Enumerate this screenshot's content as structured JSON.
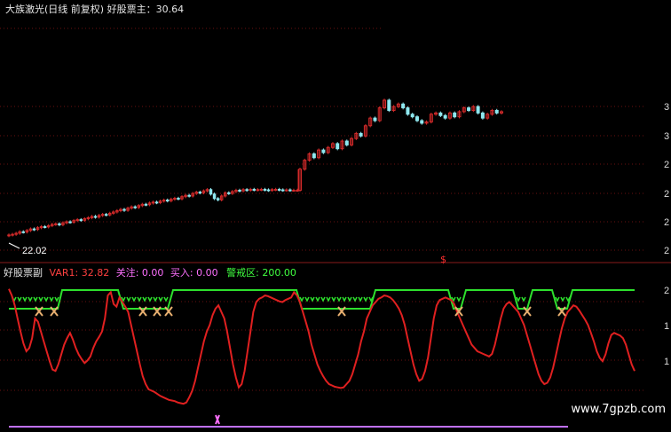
{
  "colors": {
    "background": "#000000",
    "candle_up": "#d42a2a",
    "candle_down": "#8fe8f0",
    "grid": "#6a1010",
    "red_line": "#e02020",
    "green_line": "#2de02d",
    "buy_marker": "#e8b070",
    "header_white": "#e6e6e6",
    "header_red": "#ff4040",
    "header_pink": "#ff70ff",
    "header_green": "#40ff40",
    "baseline": "#c070ff"
  },
  "main_panel": {
    "indicator_title": "大族激光(日线 前复权) 好股票主：",
    "indicator_value": "30.64",
    "low_label": "22.02",
    "bottom_mark": "$",
    "axis_ticks_right": [
      "3",
      "3",
      "2",
      "2",
      "2",
      "2"
    ]
  },
  "sub_panel": {
    "name": "好股票副",
    "var1_label": "VAR1:",
    "var1_value": "32.82",
    "focus_label": "关注:",
    "focus_value": "0.00",
    "buy_label": "买入:",
    "buy_value": "0.00",
    "alert_label": "警戒区:",
    "alert_value": "200.00",
    "axis_ticks_right": [
      "2",
      "1",
      "1"
    ]
  },
  "watermark": "www.7gpzb.com",
  "chart_data": [
    {
      "type": "candlestick",
      "title": "大族激光(日线 前复权)",
      "ylim": [
        21,
        33.5
      ],
      "x": [
        0,
        1,
        2,
        3,
        4,
        5,
        6,
        7,
        8,
        9,
        10,
        11,
        12,
        13,
        14,
        15,
        16,
        17,
        18,
        19,
        20,
        21,
        22,
        23,
        24,
        25,
        26,
        27,
        28,
        29,
        30,
        31,
        32,
        33,
        34,
        35,
        36,
        37,
        38,
        39,
        40,
        41,
        42,
        43,
        44,
        45,
        46,
        47,
        48,
        49,
        50,
        51,
        52,
        53,
        54,
        55,
        56,
        57,
        58,
        59,
        60,
        61,
        62,
        63,
        64,
        65,
        66,
        67,
        68,
        69,
        70,
        71,
        72,
        73,
        74,
        75,
        76,
        77,
        78,
        79,
        80,
        81,
        82,
        83,
        84,
        85,
        86,
        87,
        88,
        89,
        90,
        91,
        92,
        93,
        94,
        95,
        96,
        97,
        98,
        99,
        100,
        101,
        102,
        103,
        104,
        105,
        106,
        107,
        108,
        109,
        110,
        111,
        112,
        113,
        114,
        115,
        116,
        117,
        118,
        119,
        120,
        121,
        122,
        123,
        124,
        125,
        126,
        127,
        128,
        129,
        130,
        131,
        132,
        133,
        134,
        135,
        136,
        137,
        138,
        139
      ],
      "close": [
        22.05,
        22.1,
        22.18,
        22.3,
        22.28,
        22.4,
        22.52,
        22.48,
        22.62,
        22.7,
        22.68,
        22.78,
        22.88,
        22.92,
        22.85,
        23.0,
        23.08,
        23.05,
        23.18,
        23.25,
        23.2,
        23.32,
        23.4,
        23.5,
        23.45,
        23.58,
        23.66,
        23.62,
        23.75,
        23.85,
        23.95,
        24.05,
        23.98,
        24.15,
        24.25,
        24.2,
        24.35,
        24.45,
        24.42,
        24.55,
        24.62,
        24.58,
        24.7,
        24.78,
        24.72,
        24.85,
        24.92,
        24.88,
        25.05,
        25.15,
        25.1,
        25.3,
        25.4,
        25.35,
        25.5,
        25.6,
        25.25,
        24.9,
        24.8,
        25.1,
        25.35,
        25.3,
        25.45,
        25.55,
        25.5,
        25.6,
        25.55,
        25.62,
        25.58,
        25.6,
        25.62,
        25.58,
        25.55,
        25.6,
        25.62,
        25.58,
        25.55,
        25.58,
        25.55,
        25.55,
        25.55,
        25.55,
        25.55,
        25.55,
        25.55,
        25.55,
        25.55,
        25.55,
        25.55,
        25.55,
        25.55,
        25.55,
        25.55,
        25.55,
        25.55,
        25.55,
        25.55,
        25.55,
        25.55,
        25.55,
        25.55,
        25.55,
        25.55,
        25.55,
        25.55,
        25.55,
        25.55,
        25.55,
        25.55,
        25.55,
        25.55,
        25.55,
        25.55,
        25.55,
        25.55,
        25.55,
        25.55,
        25.55,
        25.55,
        25.55,
        25.55,
        25.55,
        25.55,
        25.55,
        25.55,
        25.55,
        25.55,
        25.55,
        25.55,
        25.55,
        25.55,
        25.55,
        25.55,
        25.55,
        25.55,
        25.55,
        25.55,
        25.55,
        25.55,
        25.55,
        25.55,
        25.55
      ],
      "close_part2": [
        27.2,
        27.9,
        28.4,
        28.1,
        28.7,
        28.5,
        28.9,
        29.2,
        28.8,
        29.4,
        29.1,
        29.6,
        30.0,
        29.8,
        30.6,
        31.2,
        31.0,
        32.0,
        32.6,
        31.8,
        32.1,
        32.3,
        32.0,
        31.5,
        31.3,
        31.0,
        30.8,
        30.9,
        31.5,
        31.6,
        31.4,
        31.2,
        31.6,
        31.3,
        31.7,
        32.0,
        31.8,
        32.1,
        31.6,
        31.2,
        31.5,
        31.8,
        31.6,
        31.7
      ],
      "low_label": 22.02,
      "indicator_value": 30.64
    },
    {
      "type": "line",
      "title": "好股票副",
      "series": [
        {
          "name": "VAR1",
          "values": [
            195,
            185,
            170,
            150,
            130,
            112,
            100,
            105,
            120,
            150,
            145,
            130,
            115,
            100,
            85,
            72,
            70,
            80,
            95,
            110,
            120,
            128,
            118,
            105,
            95,
            88,
            82,
            86,
            92,
            105,
            115,
            122,
            130,
            150,
            185,
            190,
            172,
            168,
            182,
            175,
            168,
            160,
            140,
            120,
            100,
            80,
            62,
            50,
            42,
            40,
            38,
            35,
            32,
            30,
            28,
            26,
            25,
            24,
            22,
            21,
            20,
            22,
            30,
            40,
            55,
            75,
            95,
            115,
            130,
            140,
            155,
            165,
            170,
            160,
            150,
            130,
            105,
            80,
            60,
            45,
            50,
            70,
            100,
            130,
            160,
            175,
            180,
            182,
            185,
            184,
            182,
            180,
            178,
            176,
            175,
            178,
            180,
            182,
            190,
            185,
            175,
            160,
            145,
            130,
            110,
            95,
            80,
            70,
            62,
            55,
            50,
            48,
            46,
            45,
            44,
            45,
            50,
            55,
            65,
            80,
            95,
            115,
            130,
            150,
            160,
            170,
            175,
            180,
            182,
            185,
            184,
            182,
            178,
            172,
            165,
            155,
            140,
            120,
            100,
            80,
            65,
            55,
            58,
            70,
            90,
            120,
            150,
            170,
            178,
            180,
            182,
            180,
            178,
            172,
            160,
            150,
            140,
            130,
            120,
            110,
            105,
            100,
            98,
            96,
            94,
            92,
            96,
            110,
            130,
            150,
            165,
            172,
            175,
            170,
            165,
            160,
            150,
            140,
            125,
            110,
            95,
            80,
            65,
            55,
            50,
            52,
            60,
            75,
            95,
            115,
            135,
            150,
            160,
            165,
            170,
            168,
            162,
            155,
            148,
            140,
            128,
            115,
            100,
            90,
            85,
            95,
            112,
            125,
            128,
            126,
            124,
            120,
            110,
            95,
            80,
            70
          ]
        },
        {
          "name": "警戒区",
          "values": [
            200
          ]
        }
      ],
      "ylim": [
        0,
        230
      ]
    }
  ]
}
